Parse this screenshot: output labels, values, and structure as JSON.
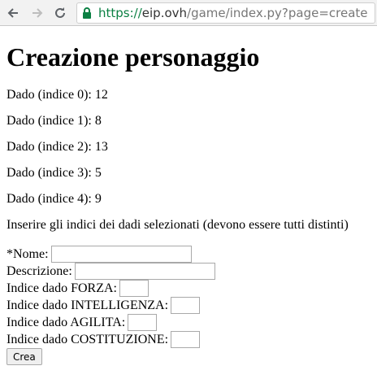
{
  "browser": {
    "url_scheme": "https://",
    "url_host": "eip.ovh",
    "url_path": "/game/index.py?page=create",
    "icons": [
      "back-icon",
      "forward-icon",
      "reload-icon",
      "lock-icon"
    ]
  },
  "page": {
    "title": "Creazione personaggio",
    "dice": [
      "Dado (indice 0): 12",
      "Dado (indice 1): 8",
      "Dado (indice 2): 13",
      "Dado (indice 3): 5",
      "Dado (indice 4): 9"
    ],
    "instructions": "Inserire gli indici dei dadi selezionati (devono essere tutti distinti)"
  },
  "form": {
    "name_label": "*Nome:",
    "name_value": "",
    "description_label": "Descrizione:",
    "description_value": "",
    "forza_label": "Indice dado FORZA:",
    "forza_value": "",
    "intelligenza_label": "Indice dado INTELLIGENZA:",
    "intelligenza_value": "",
    "agilita_label": "Indice dado AGILITA:",
    "agilita_value": "",
    "costituzione_label": "Indice dado COSTITUZIONE:",
    "costituzione_value": "",
    "submit_label": "Crea"
  }
}
